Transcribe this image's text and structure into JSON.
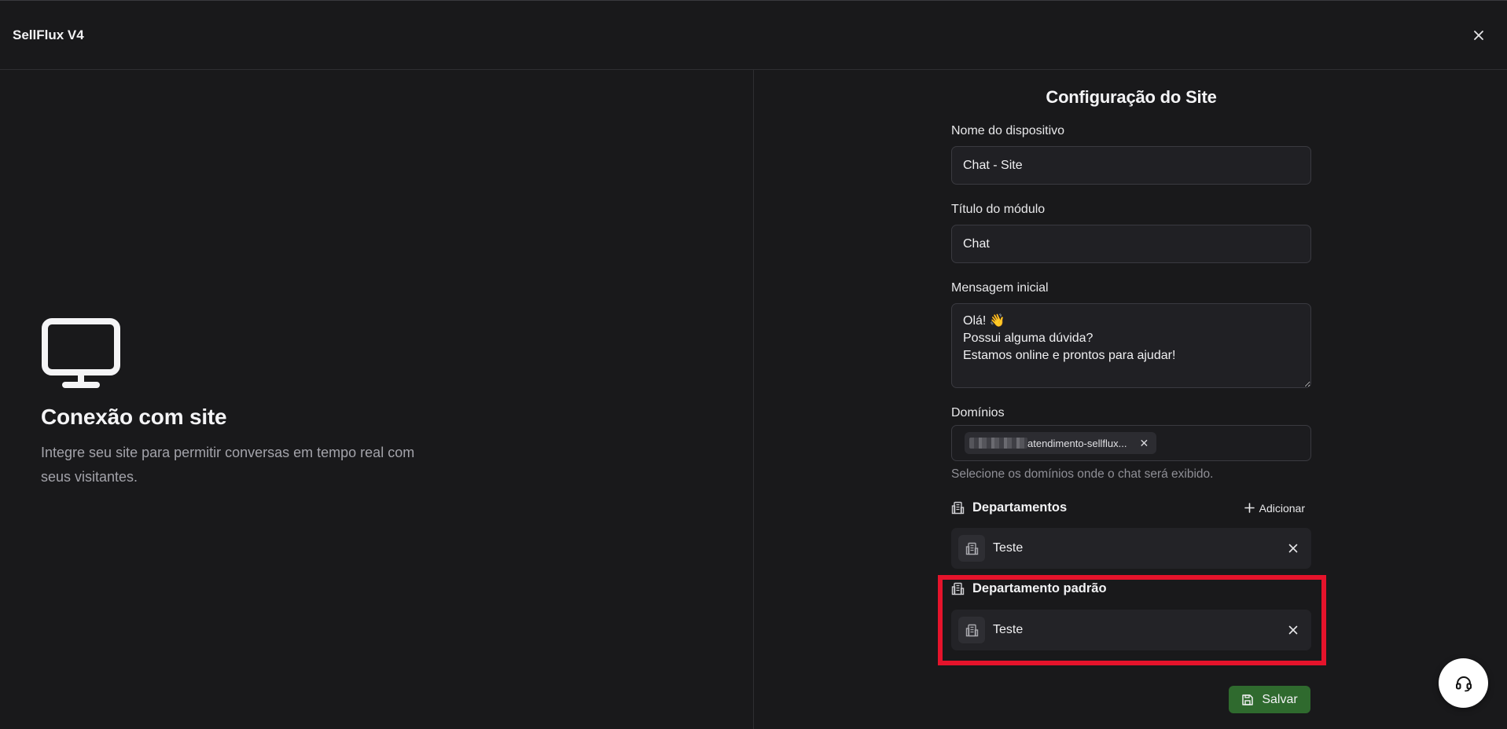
{
  "header": {
    "app_title": "SellFlux V4"
  },
  "left": {
    "title": "Conexão com site",
    "description": "Integre seu site para permitir conversas em tempo real com seus visitantes."
  },
  "form": {
    "title": "Configuração do Site",
    "device_name_label": "Nome do dispositivo",
    "device_name_value": "Chat - Site",
    "module_title_label": "Título do módulo",
    "module_title_value": "Chat",
    "initial_message_label": "Mensagem inicial",
    "initial_message_value": "Olá! 👋\nPossui alguma dúvida?\nEstamos online e prontos para ajudar!",
    "domains_label": "Domínios",
    "domain_chip_text": "atendimento-sellflux...",
    "domains_helper": "Selecione os domínios onde o chat será exibido.",
    "departments_title": "Departamentos",
    "add_label": "Adicionar",
    "departments": [
      {
        "name": "Teste"
      }
    ],
    "default_department_title": "Departamento padrão",
    "default_department": {
      "name": "Teste"
    },
    "save_label": "Salvar"
  },
  "icons": {
    "close": "close-icon",
    "monitor": "monitor-icon",
    "building": "building-icon",
    "plus": "plus-icon",
    "save": "floppy-disk-icon",
    "support": "headset-icon"
  },
  "colors": {
    "background": "#19191b",
    "save_button": "#2f6a2e",
    "highlight": "#e5132b"
  }
}
